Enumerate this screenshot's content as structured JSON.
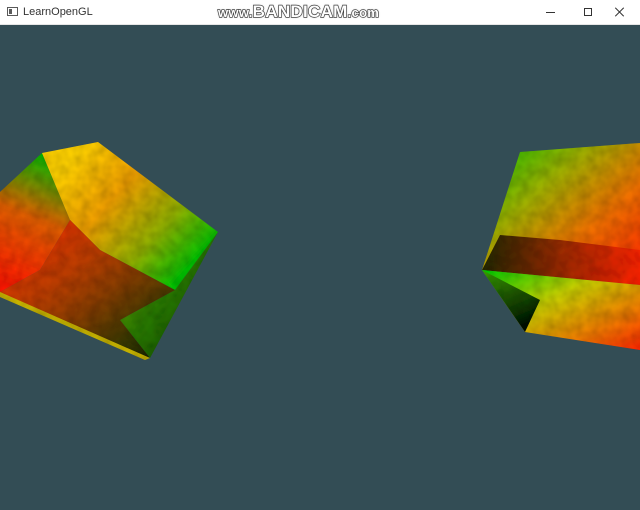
{
  "window": {
    "title": "LearnOpenGL",
    "icon": "app-window-icon"
  },
  "watermark": {
    "prefix": "www.",
    "brand": "BANDICAM",
    "suffix": ".com"
  },
  "controls": {
    "minimize_icon": "minimize-icon",
    "maximize_icon": "maximize-icon",
    "close_icon": "close-icon"
  },
  "scene": {
    "clear_color": "#334d55",
    "objects": [
      "left-cube",
      "right-cube"
    ],
    "face_colors": {
      "green": "#00c800",
      "yellow": "#e6d200",
      "orange": "#f08c00",
      "red": "#ff2000",
      "dark": "#0a1400"
    }
  }
}
